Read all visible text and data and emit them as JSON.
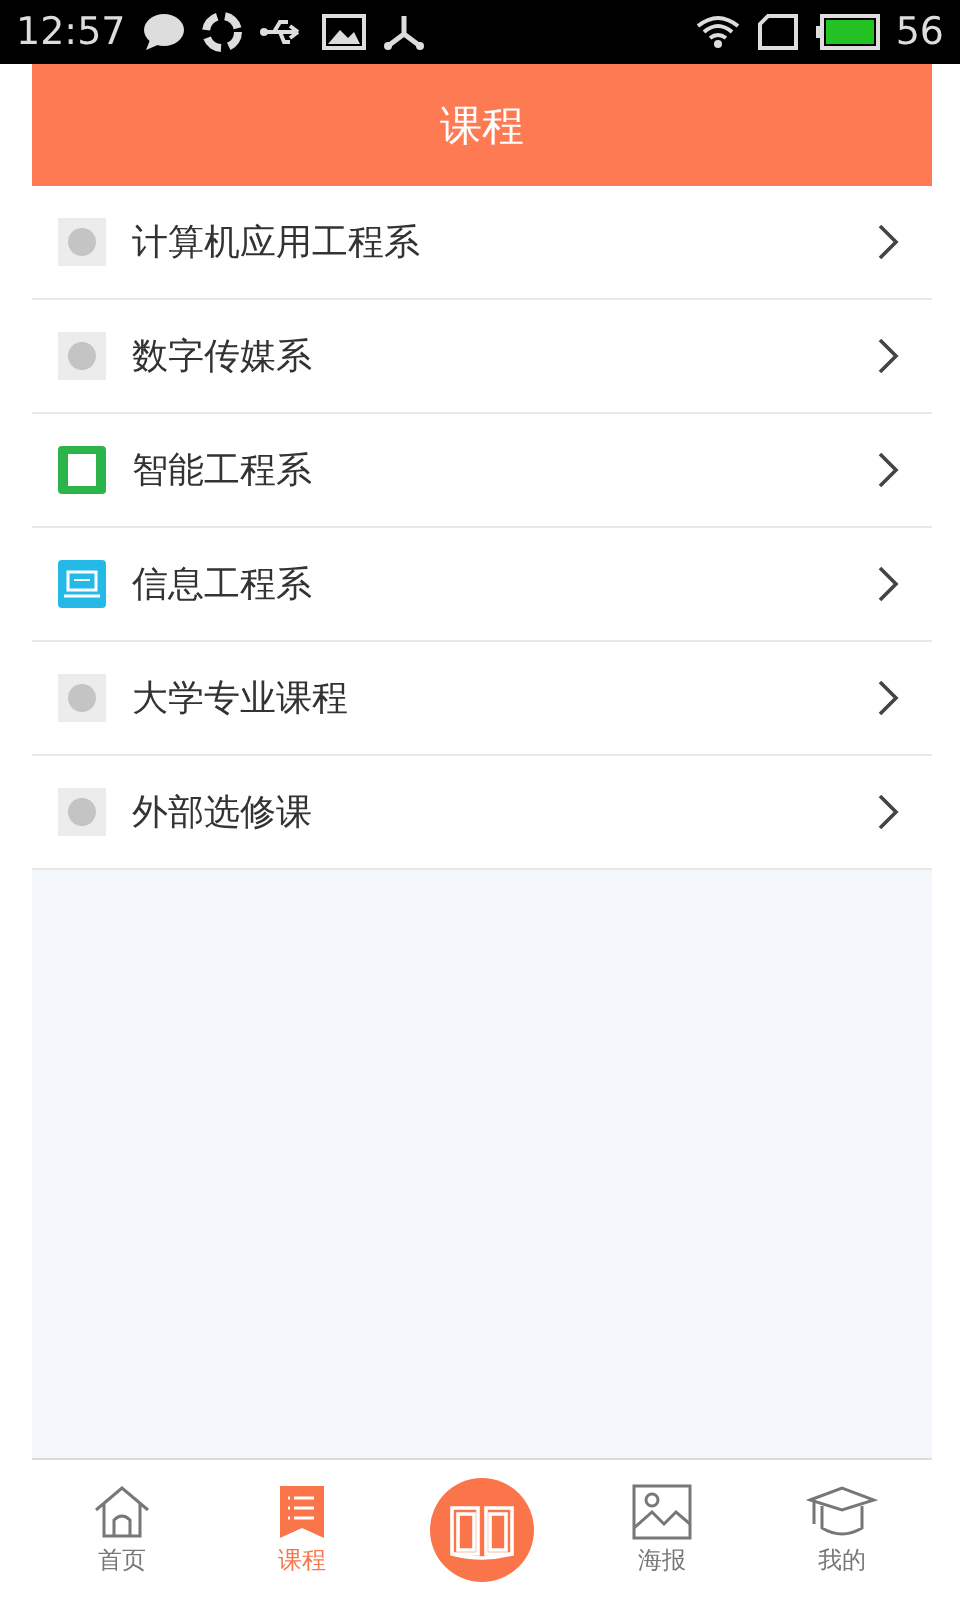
{
  "status_bar": {
    "time": "12:57",
    "battery_text": "56"
  },
  "header": {
    "title": "课程"
  },
  "items": [
    {
      "label": "计算机应用工程系",
      "kind": "placeholder"
    },
    {
      "label": "数字传媒系",
      "kind": "placeholder"
    },
    {
      "label": "智能工程系",
      "kind": "book"
    },
    {
      "label": "信息工程系",
      "kind": "laptop"
    },
    {
      "label": "大学专业课程",
      "kind": "placeholder"
    },
    {
      "label": "外部选修课",
      "kind": "placeholder"
    }
  ],
  "tabs": [
    {
      "label": "首页",
      "kind": "home",
      "selected": false
    },
    {
      "label": "课程",
      "kind": "list",
      "selected": true
    },
    {
      "kind": "center"
    },
    {
      "label": "海报",
      "kind": "poster",
      "selected": false
    },
    {
      "label": "我的",
      "kind": "cap",
      "selected": false
    }
  ]
}
